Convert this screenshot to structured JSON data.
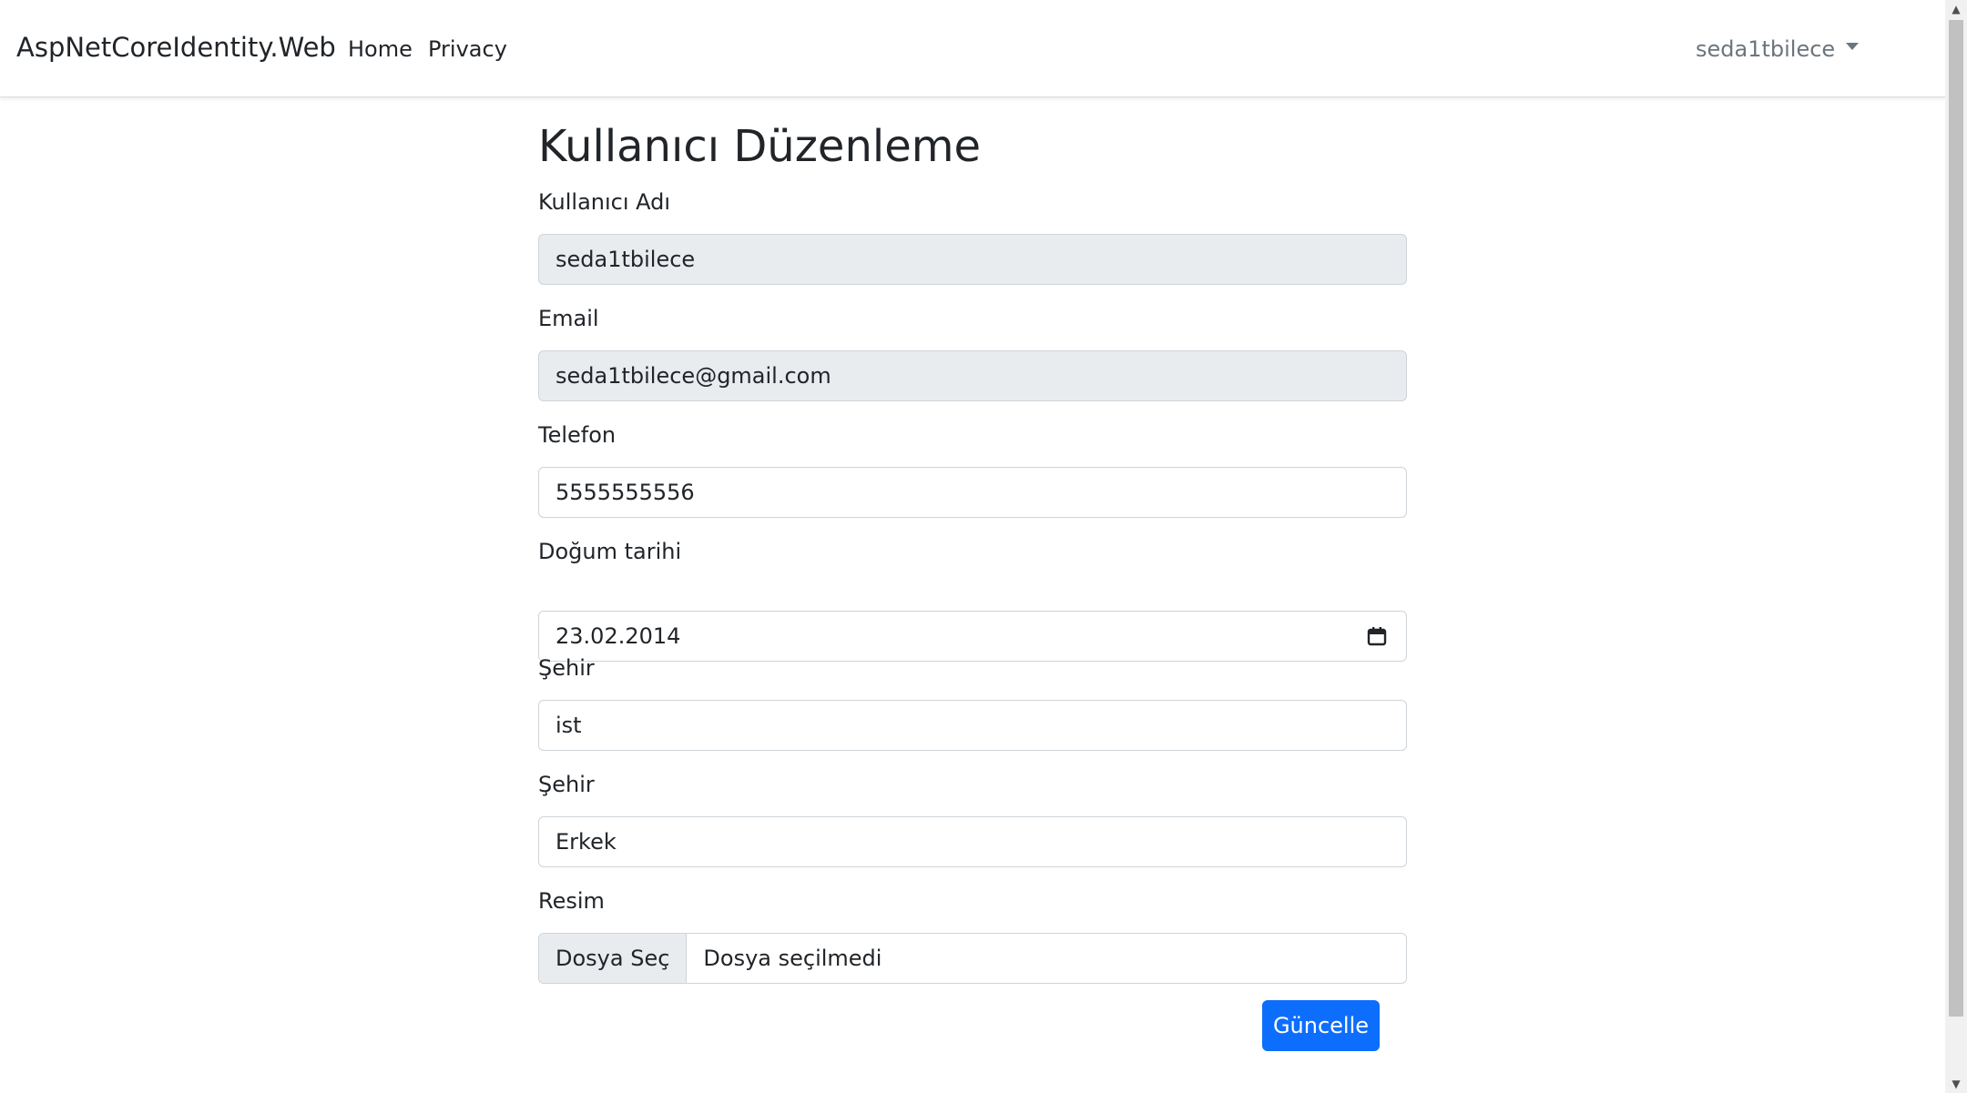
{
  "navbar": {
    "brand": "AspNetCoreIdentity.Web",
    "links": [
      {
        "label": "Home"
      },
      {
        "label": "Privacy"
      }
    ],
    "user": "seda1tbilece"
  },
  "page": {
    "title": "Kullanıcı Düzenleme"
  },
  "form": {
    "username": {
      "label": "Kullanıcı Adı",
      "value": "seda1tbilece"
    },
    "email": {
      "label": "Email",
      "value": "seda1tbilece@gmail.com"
    },
    "phone": {
      "label": "Telefon",
      "value": "5555555556"
    },
    "birthdate": {
      "label": "Doğum tarihi",
      "value": "23.02.2014"
    },
    "city": {
      "label": "Şehir",
      "value": "ist"
    },
    "gender": {
      "label": "Şehir",
      "value": "Erkek"
    },
    "picture": {
      "label": "Resim",
      "button_label": "Dosya Seç",
      "file_status": "Dosya seçilmedi"
    },
    "submit_label": "Güncelle"
  },
  "colors": {
    "primary": "#0d6efd",
    "readonly_bg": "#e9ecef",
    "border": "#ced4da",
    "muted": "#6c757d"
  },
  "icons": {
    "date": "calendar-icon",
    "dropdown": "caret-down-icon"
  }
}
